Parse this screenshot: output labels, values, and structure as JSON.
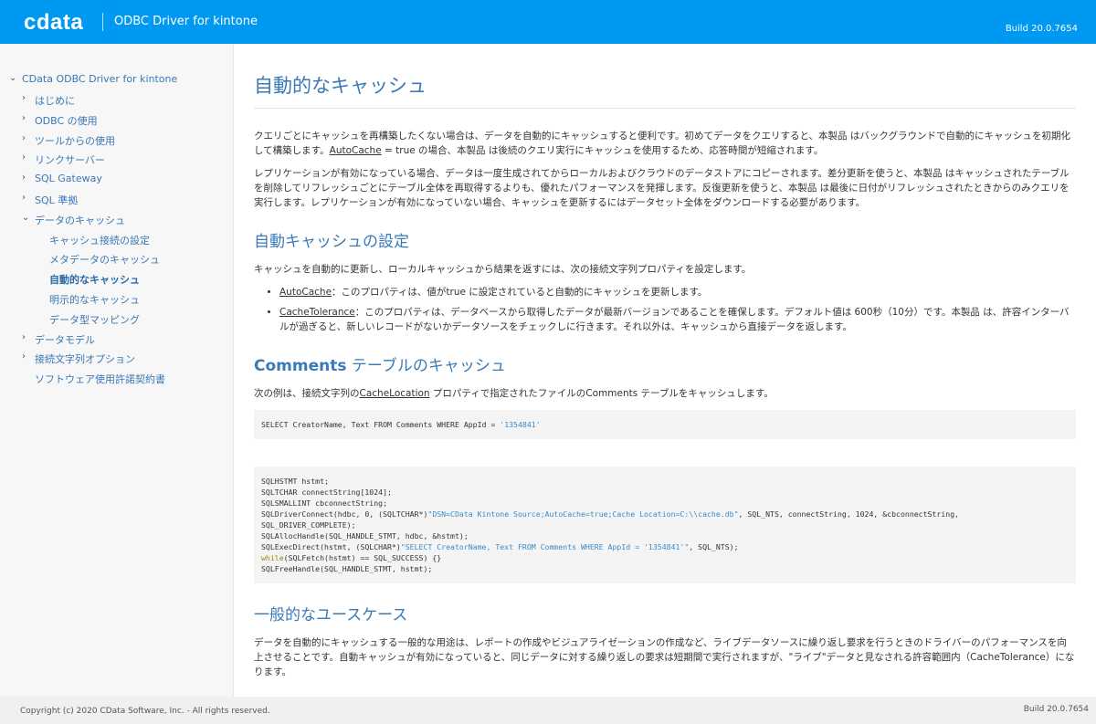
{
  "header": {
    "logo": "cdata",
    "product": "ODBC Driver for kintone",
    "build": "Build 20.0.7654"
  },
  "sidebar": {
    "root": "CData ODBC Driver for kintone",
    "items": [
      {
        "label": "はじめに",
        "chev": "›"
      },
      {
        "label": "ODBC の使用",
        "chev": "›"
      },
      {
        "label": "ツールからの使用",
        "chev": "›"
      },
      {
        "label": "リンクサーバー",
        "chev": "›"
      },
      {
        "label": "SQL Gateway",
        "chev": "›"
      },
      {
        "label": "SQL 準拠",
        "chev": "›"
      },
      {
        "label": "データのキャッシュ",
        "chev": "⌄"
      },
      {
        "label": "キャッシュ接続の設定",
        "sub": true
      },
      {
        "label": "メタデータのキャッシュ",
        "sub": true
      },
      {
        "label": "自動的なキャッシュ",
        "sub": true,
        "active": true
      },
      {
        "label": "明示的なキャッシュ",
        "sub": true
      },
      {
        "label": "データ型マッピング",
        "sub": true
      },
      {
        "label": "データモデル",
        "chev": "›"
      },
      {
        "label": "接続文字列オプション",
        "chev": "›"
      },
      {
        "label": "ソフトウェア使用許諾契約書"
      }
    ]
  },
  "main": {
    "title": "自動的なキャッシュ",
    "p1a": "クエリごとにキャッシュを再構築したくない場合は、データを自動的にキャッシュすると便利です。初めてデータをクエリすると、本製品 はバックグラウンドで自動的にキャッシュを初期化して構築します。",
    "p1link": "AutoCache",
    "p1b": " = true の場合、本製品 は後続のクエリ実行にキャッシュを使用するため、応答時間が短縮されます。",
    "p2": "レプリケーションが有効になっている場合、データは一度生成されてからローカルおよびクラウドのデータストアにコピーされます。差分更新を使うと、本製品 はキャッシュされたテーブルを削除してリフレッシュごとにテーブル全体を再取得するよりも、優れたパフォーマンスを発揮します。反復更新を使うと、本製品 は最後に日付がリフレッシュされたときからのみクエリを実行します。レプリケーションが有効になっていない場合、キャッシュを更新するにはデータセット全体をダウンロードする必要があります。",
    "h2a": "自動キャッシュの設定",
    "p3": "キャッシュを自動的に更新し、ローカルキャッシュから結果を返すには、次の接続文字列プロパティを設定します。",
    "b1link": "AutoCache",
    "b1": "：このプロパティは、値がtrue に設定されていると自動的にキャッシュを更新します。",
    "b2link": "CacheTolerance",
    "b2": "：このプロパティは、データベースから取得したデータが最新バージョンであることを確保します。デフォルト値は 600秒（10分）です。本製品 は、許容インターバルが過ぎると、新しいレコードがないかデータソースをチェックしに行きます。それ以外は、キャッシュから直接データを返します。",
    "h2b_bold": "Comments",
    "h2b": " テーブルのキャッシュ",
    "p4a": "次の例は、接続文字列の",
    "p4link": "CacheLocation",
    "p4b": " プロパティで指定されたファイルのComments テーブルをキャッシュします。",
    "code1a": "SELECT CreatorName, Text FROM Comments WHERE AppId = ",
    "code1s": "'1354841'",
    "code2": [
      [
        [
          "",
          "SQLHSTMT hstmt;"
        ]
      ],
      [
        [
          "",
          "SQLTCHAR connectString[1024];"
        ]
      ],
      [
        [
          "",
          "SQLSMALLINT cbconnectString;"
        ]
      ],
      [
        [
          "",
          "SQLDriverConnect(hdbc, 0, (SQLTCHAR*)"
        ],
        [
          "str",
          "\"DSN=CData Kintone Source;AutoCache=true;Cache Location=C:\\\\cache.db\""
        ],
        [
          "",
          ", SQL_NTS, connectString, 1024, &cbconnectString,"
        ]
      ],
      [
        [
          "",
          "SQL_DRIVER_COMPLETE);"
        ]
      ],
      [
        [
          "",
          "SQLAllocHandle(SQL_HANDLE_STMT, hdbc, &hstmt);"
        ]
      ],
      [
        [
          "",
          "SQLExecDirect(hstmt, (SQLCHAR*)"
        ],
        [
          "str",
          "\"SELECT CreatorName, Text FROM Comments WHERE AppId = '1354841'\""
        ],
        [
          "",
          ", SQL_NTS);"
        ]
      ],
      [
        [
          "kw",
          "while"
        ],
        [
          "",
          "(SQLFetch(hstmt) == SQL_SUCCESS) {}"
        ]
      ],
      [
        [
          "",
          "SQLFreeHandle(SQL_HANDLE_STMT, hstmt);"
        ]
      ]
    ],
    "h2c": "一般的なユースケース",
    "p5": "データを自動的にキャッシュする一般的な用途は、レポートの作成やビジュアライゼーションの作成など、ライブデータソースに繰り返し要求を行うときのドライバーのパフォーマンスを向上させることです。自動キャッシュが有効になっていると、同じデータに対する繰り返しの要求は短期間で実行されますが、\"ライブ\"データと見なされる許容範囲内（CacheTolerance）になります。"
  },
  "footer": {
    "copyright": "Copyright (c) 2020 CData Software, Inc. - All rights reserved.",
    "build": "Build 20.0.7654"
  }
}
